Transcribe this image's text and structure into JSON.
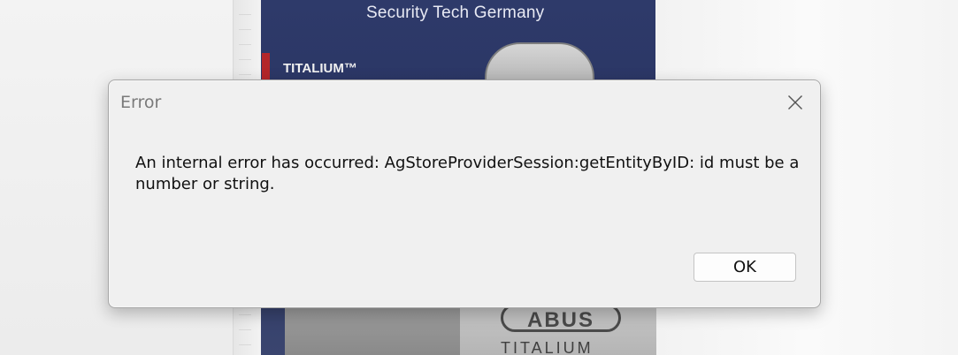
{
  "background": {
    "package_header": "Security Tech Germany",
    "package_label": "TITALIUM™",
    "logo_text": "ABUS",
    "logo_subtext": "TITALIUM"
  },
  "dialog": {
    "title": "Error",
    "message": "An internal error has occurred: AgStoreProviderSession:getEntityByID: id must be a number or string.",
    "ok_label": "OK",
    "close_icon": "close-icon"
  }
}
